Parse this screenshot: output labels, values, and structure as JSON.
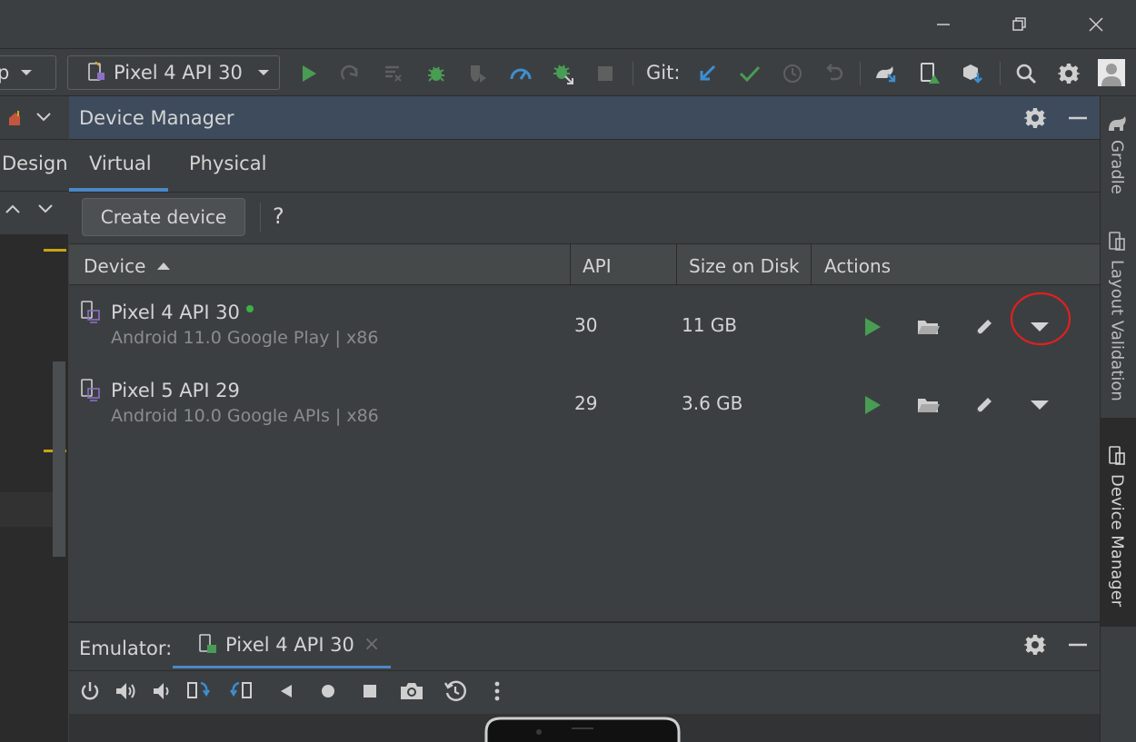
{
  "titlebar": {
    "minimize_label": "—",
    "restore_label": "❐",
    "close_label": "✕"
  },
  "toolbar": {
    "app_combo": "p",
    "device_combo": "Pixel 4 API 30",
    "git_label": "Git:"
  },
  "left": {
    "design_label": "Design"
  },
  "device_manager": {
    "title": "Device Manager",
    "tabs": [
      {
        "label": "Virtual",
        "active": true
      },
      {
        "label": "Physical",
        "active": false
      }
    ],
    "create_button": "Create device",
    "help": "?",
    "columns": [
      "Device",
      "API",
      "Size on Disk",
      "Actions"
    ],
    "sort_indicator": "▲",
    "devices": [
      {
        "name": "Pixel 4 API 30",
        "subtitle": "Android 11.0 Google Play | x86",
        "api": "30",
        "size": "11 GB",
        "running": true
      },
      {
        "name": "Pixel 5 API 29",
        "subtitle": "Android 10.0 Google APIs | x86",
        "api": "29",
        "size": "3.6 GB",
        "running": false
      }
    ]
  },
  "emulator": {
    "label": "Emulator:",
    "tab": "Pixel 4 API 30",
    "close_tab": "×"
  },
  "sidebar": {
    "tabs": [
      "Gradle",
      "Layout Validation",
      "Device Manager"
    ]
  },
  "colors": {
    "accent_blue": "#4a88c7",
    "run_green": "#499c54",
    "running_dot": "#3cb04a",
    "highlight_circle": "#e02020",
    "marker_yellow": "#c8a414"
  }
}
